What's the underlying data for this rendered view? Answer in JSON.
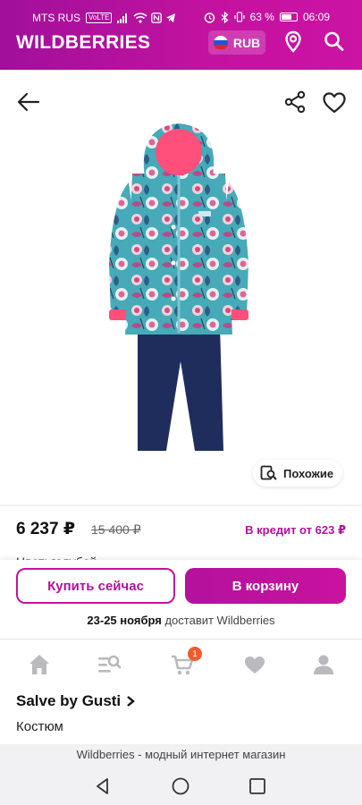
{
  "status_bar": {
    "carrier": "MTS RUS",
    "volte": "VoLTE",
    "battery": "63 %",
    "time": "06:09"
  },
  "header": {
    "brand": "WILDBERRIES",
    "currency": "RUB",
    "icons": [
      "location-icon",
      "search-icon"
    ]
  },
  "product": {
    "similar_label": "Похожие",
    "price": "6 237 ₽",
    "old_price": "15 400 ₽",
    "credit": "В кредит от 623 ₽",
    "color_label": "Цвет: голубой"
  },
  "actions": {
    "buy_now": "Купить сейчас",
    "add_to_cart": "В корзину",
    "delivery_date": "23-25 ноября",
    "delivery_rest": " доставит Wildberries"
  },
  "nav": {
    "cart_badge": "1",
    "items": [
      "home-icon",
      "catalog-search-icon",
      "cart-icon",
      "favorites-icon",
      "profile-icon"
    ]
  },
  "info": {
    "brand_name": "Salve by Gusti",
    "product_name": "Костюм"
  },
  "footer": {
    "site_title": "Wildberries - модный интернет магазин"
  },
  "colors": {
    "accent": "#c4129f",
    "jacket": "#46aab8",
    "pants": "#1f2d5c",
    "hood_lining": "#ff4f7a"
  }
}
